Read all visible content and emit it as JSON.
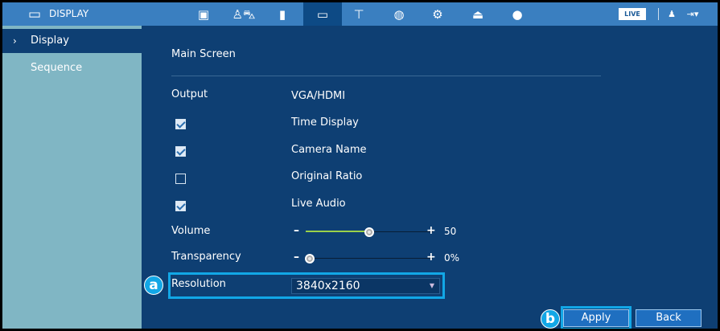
{
  "header": {
    "title": "DISPLAY",
    "live_label": "LIVE",
    "icons": [
      "monitor-icon",
      "playback-icon",
      "person-vehicle-icon",
      "usb-icon",
      "display-icon",
      "camera-icon",
      "network-icon",
      "settings-icon",
      "storage-icon",
      "account-icon",
      "user-icon",
      "logout-icon"
    ]
  },
  "sidebar": {
    "items": [
      {
        "label": "Display",
        "selected": true
      },
      {
        "label": "Sequence",
        "selected": false
      }
    ]
  },
  "main": {
    "section_title": "Main Screen",
    "output_label": "Output",
    "output_value": "VGA/HDMI",
    "checkboxes": [
      {
        "label": "Time Display",
        "checked": true
      },
      {
        "label": "Camera Name",
        "checked": true
      },
      {
        "label": "Original Ratio",
        "checked": false
      },
      {
        "label": "Live Audio",
        "checked": true
      }
    ],
    "volume": {
      "label": "Volume",
      "value": "50",
      "fraction": 0.5
    },
    "transparency": {
      "label": "Transparency",
      "value": "0%",
      "fraction": 0
    },
    "resolution": {
      "label": "Resolution",
      "value": "3840x2160"
    },
    "apply_label": "Apply",
    "back_label": "Back"
  },
  "annotations": {
    "a": "a",
    "b": "b",
    "color": "#12a7e6"
  }
}
